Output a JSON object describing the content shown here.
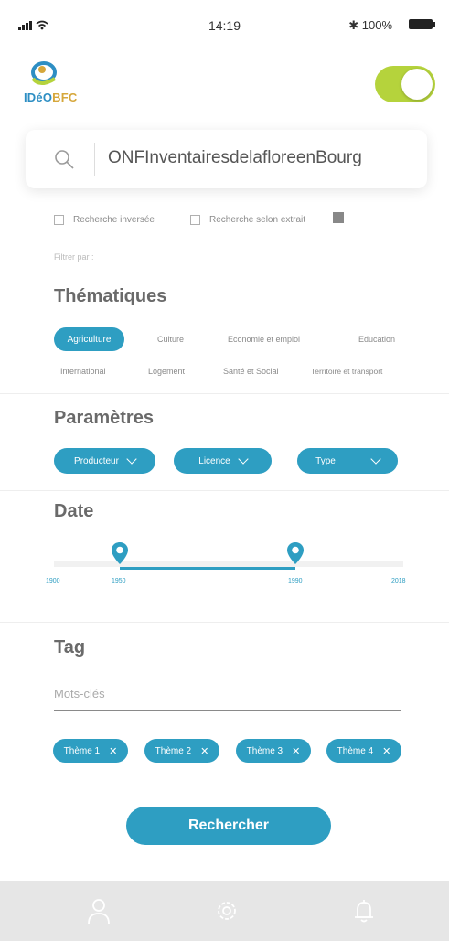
{
  "status": {
    "time": "14:19",
    "bluetooth": "✱",
    "battery": "100%"
  },
  "logo": {
    "part1": "IDéO",
    "part2": "BFC"
  },
  "search": {
    "value": "ONFInventairesdelafloreenBourg"
  },
  "options": {
    "reverse": "Recherche inversée",
    "extract": "Recherche selon extrait"
  },
  "filter_label": "Filtrer par :",
  "thematiques": {
    "title": "Thématiques",
    "selected": "Agriculture",
    "items": [
      "Culture",
      "Economie et emploi",
      "Education",
      "International",
      "Logement",
      "Santé et Social",
      "Territoire et transport"
    ]
  },
  "parametres": {
    "title": "Paramètres",
    "producteur": "Producteur",
    "licence": "Licence",
    "type": "Type"
  },
  "date": {
    "title": "Date",
    "ticks": [
      "1900",
      "1950",
      "1990",
      "2018"
    ],
    "range_start": "1950",
    "range_end": "1990"
  },
  "tag": {
    "title": "Tag",
    "placeholder": "Mots-clés",
    "tags": [
      "Thème 1",
      "Thème 2",
      "Thème 3",
      "Thème 4"
    ]
  },
  "submit": "Rechercher",
  "tabs": [
    "profile-icon",
    "settings-icon",
    "bell-icon"
  ],
  "colors": {
    "accent": "#2e9ec2",
    "toggle": "#b5d33c"
  }
}
